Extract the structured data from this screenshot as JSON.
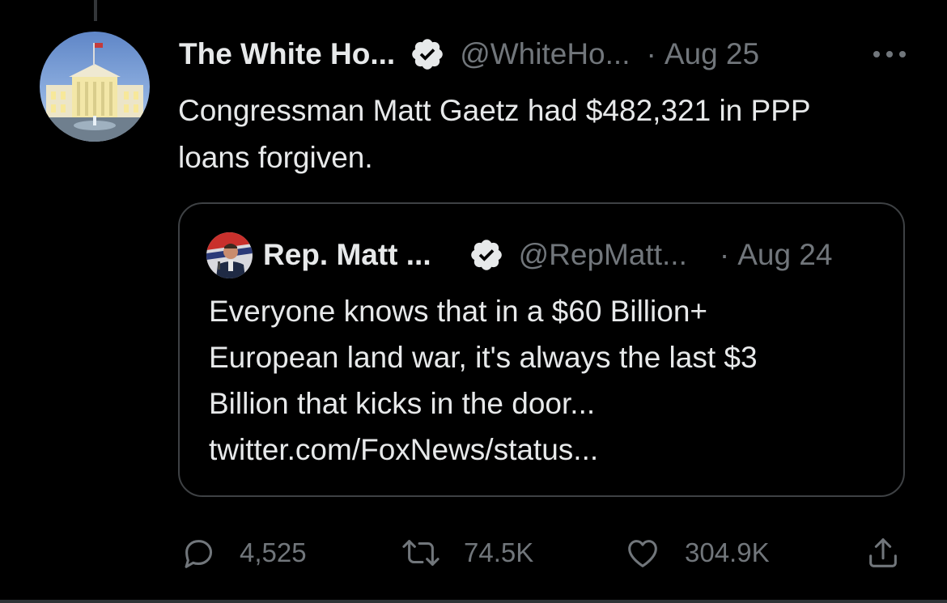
{
  "tweet": {
    "author_name": "The White Ho...",
    "handle": "@WhiteHo...",
    "separator": "·",
    "date": "Aug 25",
    "text": "Congressman Matt Gaetz had $482,321 in PPP loans forgiven.",
    "text_lines": [
      "Congressman Matt Gaetz had $482,321 in PPP",
      "loans forgiven."
    ],
    "verified_icon": "verified-badge-icon",
    "more_icon": "more-options-icon"
  },
  "quote": {
    "author_name": "Rep. Matt ...",
    "handle": "@RepMatt...",
    "separator": "·",
    "date": "Aug 24",
    "text_lines": [
      "Everyone knows that in a $60 Billion+",
      "European land war, it's always the last $3",
      "Billion that kicks in the door...",
      "twitter.com/FoxNews/status..."
    ]
  },
  "actions": {
    "replies": "4,525",
    "retweets": "74.5K",
    "likes": "304.9K",
    "reply_icon": "reply-icon",
    "retweet_icon": "retweet-icon",
    "like_icon": "heart-icon",
    "share_icon": "share-icon"
  },
  "colors": {
    "background": "#000000",
    "text_primary": "#e7e9ea",
    "text_secondary": "#71767b",
    "border": "#3e4144",
    "verified_badge": "#e7e9ea"
  }
}
